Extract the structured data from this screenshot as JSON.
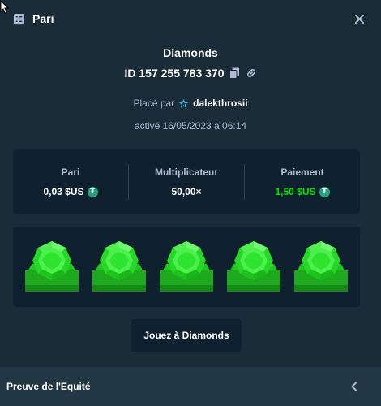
{
  "header": {
    "title": "Pari",
    "icon": "receipt-icon",
    "close_icon": "close-icon"
  },
  "bet": {
    "game": "Diamonds",
    "id": "ID 157 255 783 370",
    "placed_prefix": "Placé par",
    "user": "dalekthrosii",
    "date": "activé 16/05/2023 à 06:14"
  },
  "stats": {
    "bet_label": "Pari",
    "bet_value": "0,03 $US",
    "multiplier_label": "Multiplicateur",
    "multiplier_value": "50,00×",
    "payout_label": "Paiement",
    "payout_value": "1,50 $US",
    "currency_icon": "tether-coin-icon"
  },
  "board": {
    "tiles": [
      "green-gem",
      "green-gem",
      "green-gem",
      "green-gem",
      "green-gem"
    ]
  },
  "play_button": "Jouez à Diamonds",
  "footer": {
    "label": "Preuve de l'Equité",
    "icon": "chevron-left-icon"
  },
  "colors": {
    "background": "#1a2c38",
    "panel": "#0f212e",
    "footer": "#213743",
    "muted_text": "#b1bad3",
    "payout_green": "#00e701",
    "gem_green": "#1fd21f",
    "coin": "#26a17b"
  }
}
